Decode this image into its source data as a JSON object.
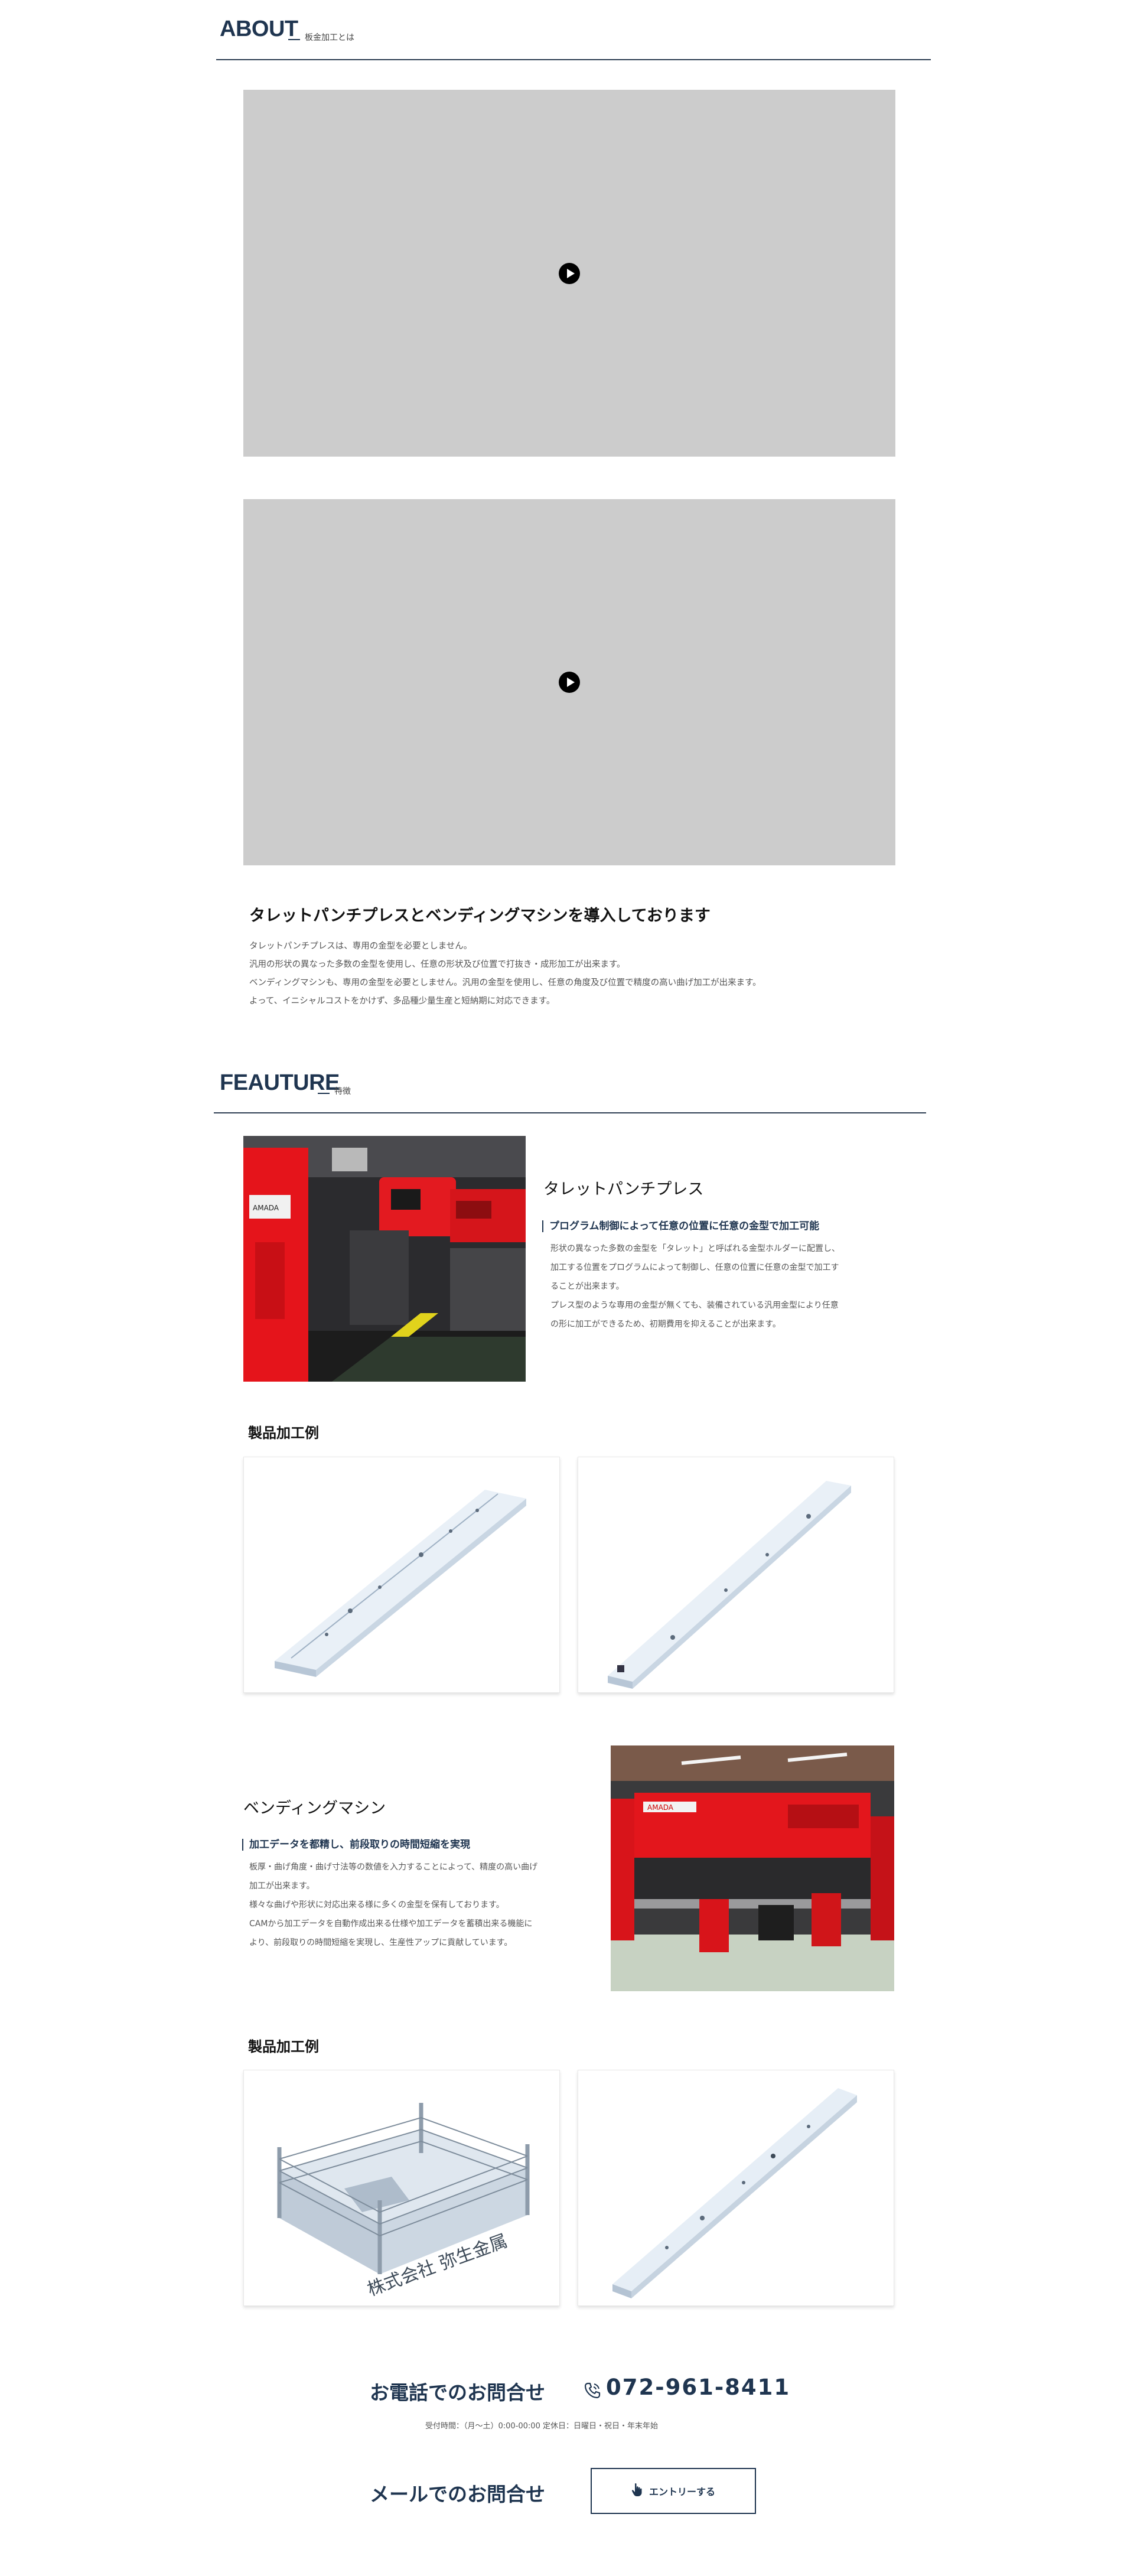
{
  "about": {
    "title": "ABOUT",
    "subtitle": "板金加工とは",
    "heading": "タレットパンチプレスとベンディングマシンを導入しております",
    "paragraphs": [
      "タレットパンチプレスは、専用の金型を必要としません。",
      "汎用の形状の異なった多数の金型を使用し、任意の形状及び位置で打抜き・成形加工が出来ます。",
      "ベンディングマシンも、専用の金型を必要としません。汎用の金型を使用し、任意の角度及び位置で精度の高い曲げ加工が出来ます。",
      "よって、イニシャルコストをかけず、多品種少量生産と短納期に対応できます。"
    ]
  },
  "feature": {
    "title": "FEAUTURE",
    "subtitle": "特徴",
    "turret": {
      "title": "タレットパンチプレス",
      "subhead": "プログラム制御によって任意の位置に任意の金型で加工可能",
      "lines": [
        "形状の異なった多数の金型を「タレット」と呼ばれる金型ホルダーに配置し、",
        "加工する位置をプログラムによって制御し、任意の位置に任意の金型で加工す",
        "ることが出来ます。",
        "プレス型のような専用の金型が無くても、装備されている汎用金型により任意",
        "の形に加工ができるため、初期費用を抑えることが出来ます。"
      ],
      "photo_text": "AMADA"
    },
    "examples_label_1": "製品加工例",
    "bending": {
      "title": "ベンディングマシン",
      "subhead": "加工データを都精し、前段取りの時間短縮を実現",
      "lines": [
        "板厚・曲げ角度・曲げ寸法等の数値を入力することによって、精度の高い曲げ",
        "加工が出来ます。",
        "様々な曲げや形状に対応出来る様に多くの金型を保有しております。",
        "CAMから加工データを自動作成出来る仕様や加工データを蓄積出来る機能に",
        "より、前段取りの時間短縮を実現し、生産性アップに貢献しています。"
      ],
      "photo_text": "AMADA"
    },
    "examples_label_2": "製品加工例",
    "ring_label": "株式会社 弥生金属"
  },
  "contact": {
    "phone_label": "お電話でのお問合せ",
    "phone_number": "072-961-8411",
    "hours": "受付時間：（月〜土）0:00-00:00 定休日：日曜日・祝日・年末年始",
    "mail_label": "メールでのお問合せ",
    "entry_button": "エントリーする"
  },
  "colors": {
    "navy": "#1f3550",
    "video_gray": "#cccccc",
    "machine_red": "#e5141b"
  },
  "icons": [
    "play-icon",
    "phone-icon",
    "pointer-hand-icon"
  ]
}
